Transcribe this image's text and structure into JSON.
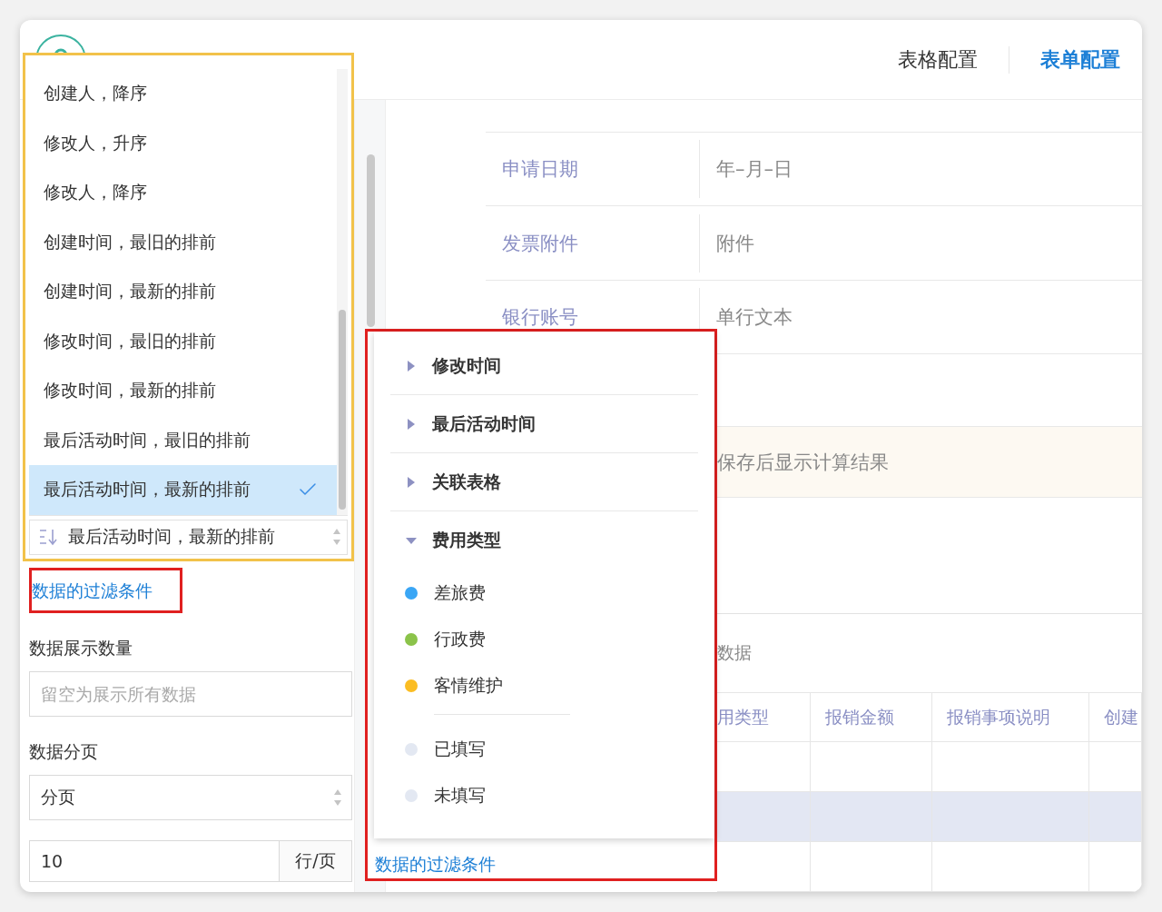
{
  "header": {
    "tabs": [
      {
        "label": "表格配置",
        "selected": false
      },
      {
        "label": "表单配置",
        "selected": true
      }
    ]
  },
  "sort_dropdown": {
    "options": [
      {
        "label": "创建人，降序",
        "selected": false
      },
      {
        "label": "修改人，升序",
        "selected": false
      },
      {
        "label": "修改人，降序",
        "selected": false
      },
      {
        "label": "创建时间，最旧的排前",
        "selected": false
      },
      {
        "label": "创建时间，最新的排前",
        "selected": false
      },
      {
        "label": "修改时间，最旧的排前",
        "selected": false
      },
      {
        "label": "修改时间，最新的排前",
        "selected": false
      },
      {
        "label": "最后活动时间，最旧的排前",
        "selected": false
      },
      {
        "label": "最后活动时间，最新的排前",
        "selected": true
      }
    ],
    "value": "最后活动时间，最新的排前"
  },
  "left_panel": {
    "filter_link": "数据的过滤条件",
    "count_label": "数据展示数量",
    "count_placeholder": "留空为展示所有数据",
    "paging_label": "数据分页",
    "paging_value": "分页",
    "page_size": "10",
    "page_size_unit": "行/页"
  },
  "form": {
    "rows": [
      {
        "label": "申请日期",
        "value": "年–月–日"
      },
      {
        "label": "发票附件",
        "value": "附件"
      },
      {
        "label": "银行账号",
        "value": "单行文本"
      }
    ],
    "computed_hint": "保存后显示计算结果",
    "subtable": {
      "title": "数据",
      "columns": [
        "用类型",
        "报销金额",
        "报销事项说明",
        "创建"
      ],
      "rows": [
        {
          "striped": false
        },
        {
          "striped": true
        },
        {
          "striped": false
        }
      ]
    }
  },
  "field_menu": {
    "groups": [
      {
        "label": "修改时间",
        "expanded": false
      },
      {
        "label": "最后活动时间",
        "expanded": false
      },
      {
        "label": "关联表格",
        "expanded": false
      },
      {
        "label": "费用类型",
        "expanded": true
      }
    ],
    "options": [
      {
        "label": "差旅费",
        "color": "#3aa6f5"
      },
      {
        "label": "行政费",
        "color": "#8bc34a"
      },
      {
        "label": "客情维护",
        "color": "#fbbd23"
      }
    ],
    "fill_states": [
      {
        "label": "已填写",
        "color": "#e3e8f2"
      },
      {
        "label": "未填写",
        "color": "#e3e8f2"
      }
    ],
    "filter_link": "数据的过滤条件"
  }
}
